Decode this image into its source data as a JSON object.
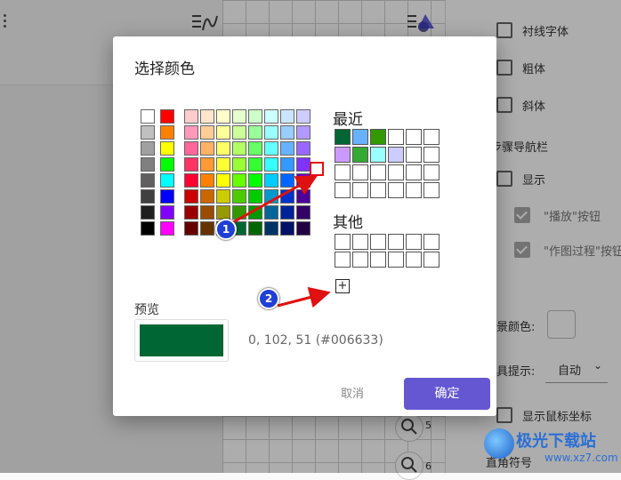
{
  "background": {
    "right_panel": {
      "items": [
        {
          "label": "衬线字体",
          "checked": false
        },
        {
          "label": "粗体",
          "checked": false
        },
        {
          "label": "斜体",
          "checked": false
        }
      ],
      "section_nav": "步骤导航栏",
      "nav_items": [
        {
          "label": "显示",
          "checked": false
        },
        {
          "label": "\"播放\"按钮",
          "checked": true
        },
        {
          "label": "\"作图过程\"按钮",
          "checked": true
        }
      ],
      "bg_color_label": "景颜色:",
      "tooltip_label": "具提示:",
      "tooltip_value": "自动",
      "show_mouse": "显示鼠标坐标",
      "coord_symbol": "直角符号"
    },
    "zoom_labels": [
      "5",
      "6"
    ]
  },
  "dialog": {
    "title": "选择颜色",
    "recent_label": "最近",
    "other_label": "其他",
    "add_label": "+",
    "preview_label": "预览",
    "preview_color": "#006633",
    "rgb_text": "0, 102, 51 (#006633)",
    "cancel_label": "取消",
    "ok_label": "确定",
    "accent": "#6557d2",
    "gray_column": [
      "#ffffff",
      "#c0c0c0",
      "#a0a0a0",
      "#808080",
      "#606060",
      "#404040",
      "#202020",
      "#000000"
    ],
    "primary_column": [
      "#ff0000",
      "#ff8000",
      "#ffff00",
      "#00ff00",
      "#00ffff",
      "#0000ff",
      "#8000ff",
      "#ff00ff"
    ],
    "palette": [
      [
        "#ffcccc",
        "#ff99bb",
        "#ff6699",
        "#ff3366",
        "#ff0033",
        "#cc0000",
        "#990000",
        "#660000"
      ],
      [
        "#ffe5cc",
        "#ffcc99",
        "#ffb266",
        "#ff9933",
        "#ff8000",
        "#cc6600",
        "#994c00",
        "#663300"
      ],
      [
        "#ffffcc",
        "#ffff99",
        "#ffff66",
        "#ffff33",
        "#ffff00",
        "#cccc00",
        "#999900",
        "#666600"
      ],
      [
        "#e5ffcc",
        "#ccff99",
        "#b2ff66",
        "#99ff33",
        "#66ff00",
        "#4ccc00",
        "#339900",
        "#006633"
      ],
      [
        "#ccffcc",
        "#99ff99",
        "#66ff66",
        "#33ff33",
        "#00ff00",
        "#00cc00",
        "#009900",
        "#006600"
      ],
      [
        "#ccffff",
        "#99ffff",
        "#66ffff",
        "#33ffff",
        "#00ccff",
        "#0099cc",
        "#006699",
        "#003366"
      ],
      [
        "#cce5ff",
        "#99ccff",
        "#66b2ff",
        "#3399ff",
        "#0066ff",
        "#0033cc",
        "#002299",
        "#001166"
      ],
      [
        "#ccccff",
        "#b299ff",
        "#9966ff",
        "#7f33ff",
        "#6600cc",
        "#4c0099",
        "#330066",
        "#220044"
      ]
    ],
    "recent_colors": [
      "#006633",
      "#66b2ff",
      "#339900",
      "#ffffff",
      "#ffffff",
      "#ffffff",
      "#cc99ff",
      "#33aa33",
      "#99ffff",
      "#ccccff",
      "#ffffff",
      "#ffffff"
    ],
    "annotations": [
      "1",
      "2"
    ]
  },
  "watermark": {
    "name": "极光下载站",
    "url": "www.xz7.com"
  }
}
